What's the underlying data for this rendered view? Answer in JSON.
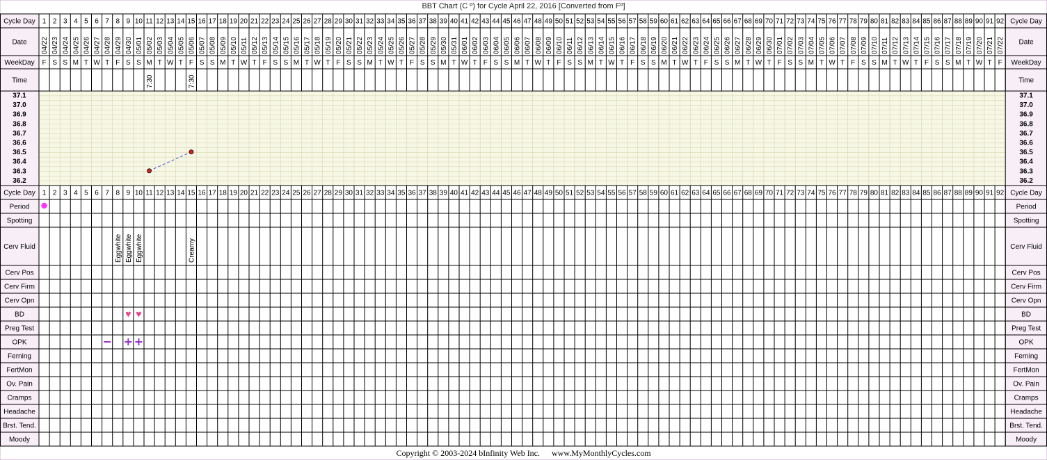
{
  "title": "BBT Chart (C º) for Cycle April 22, 2016  [Converted from Fº]",
  "footer": {
    "copyright": "Copyright © 2003-2024 bInfinity Web Inc.",
    "site": "www.MyMonthlyCycles.com"
  },
  "colors": {
    "label_bg": "#f7eef7",
    "grid_bg": "#f7f7e6",
    "temp_point": "#e02020",
    "temp_line": "#4444dd",
    "period": "#ff33ff",
    "bd_heart": "#e8438a",
    "opk_negative": "#9933cc",
    "opk_positive": "#9933cc"
  },
  "row_labels": {
    "cycle_day": "Cycle Day",
    "date": "Date",
    "weekday": "WeekDay",
    "time": "Time",
    "period": "Period",
    "spotting": "Spotting",
    "cerv_fluid": "Cerv Fluid",
    "cerv_pos": "Cerv Pos",
    "cerv_firm": "Cerv Firm",
    "cerv_opn": "Cerv Opn",
    "bd": "BD",
    "preg_test": "Preg Test",
    "opk": "OPK",
    "ferning": "Ferning",
    "fertmon": "FertMon",
    "ov_pain": "Ov. Pain",
    "cramps": "Cramps",
    "headache": "Headache",
    "brst_tend": "Brst. Tend.",
    "moody": "Moody"
  },
  "temperature_labels": [
    "37.1",
    "37.0",
    "36.9",
    "36.8",
    "36.7",
    "36.6",
    "36.5",
    "36.4",
    "36.3",
    "36.2"
  ],
  "chart_data": {
    "type": "line",
    "title": "BBT Chart (C º) for Cycle April 22, 2016  [Converted from Fº]",
    "xlabel": "Cycle Day",
    "ylabel": "",
    "ylim": [
      36.2,
      37.1
    ],
    "grid": true,
    "days": 92,
    "start_date": "2016-04-22",
    "first_weekday": "F",
    "series": [
      {
        "values": [
          {
            "day": 11,
            "temp": 36.3
          },
          {
            "day": 15,
            "temp": 36.5
          }
        ]
      }
    ],
    "times": [
      {
        "day": 11,
        "value": "7:30"
      },
      {
        "day": 15,
        "value": "7:30"
      }
    ],
    "period": [
      1
    ],
    "cerv_fluid": [
      {
        "day": 8,
        "value": "Eggwhite"
      },
      {
        "day": 9,
        "value": "Eggwhite"
      },
      {
        "day": 10,
        "value": "Eggwhite"
      },
      {
        "day": 15,
        "value": "Creamy"
      }
    ],
    "bd": [
      9,
      10
    ],
    "opk": [
      {
        "day": 7,
        "result": "negative"
      },
      {
        "day": 9,
        "result": "positive"
      },
      {
        "day": 10,
        "result": "positive"
      }
    ]
  }
}
